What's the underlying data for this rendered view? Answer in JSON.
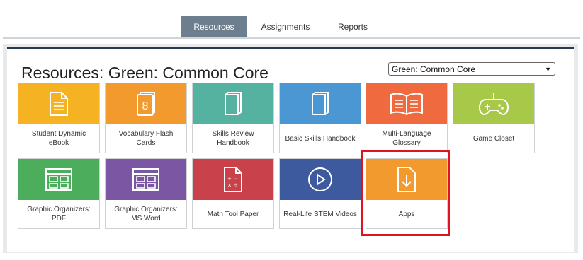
{
  "nav": {
    "tabs": [
      {
        "label": "Resources"
      },
      {
        "label": "Assignments"
      },
      {
        "label": "Reports"
      }
    ]
  },
  "page": {
    "title": "Resources: Green: Common Core",
    "select_value": "Green: Common Core"
  },
  "colors": {
    "nav_active": "#6d7f8e",
    "panel_header": "#273b4d",
    "highlight": "#e0141e"
  },
  "tiles": [
    {
      "label": "Student Dynamic eBook",
      "color": "#f5b324",
      "icon": "document-icon"
    },
    {
      "label": "Vocabulary Flash Cards",
      "color": "#f29a2e",
      "icon": "flashcards-icon"
    },
    {
      "label": "Skills Review Handbook",
      "color": "#56b2a0",
      "icon": "book-icon"
    },
    {
      "label": "Basic Skills Handbook",
      "color": "#4a97d3",
      "icon": "book-icon"
    },
    {
      "label": "Multi-Language Glossary",
      "color": "#ef6a3f",
      "icon": "open-book-icon"
    },
    {
      "label": "Game Closet",
      "color": "#a8c84a",
      "icon": "gamepad-icon"
    },
    {
      "label": "Graphic Organizers: PDF",
      "color": "#4cae5d",
      "icon": "organizer-icon"
    },
    {
      "label": "Graphic Organizers: MS Word",
      "color": "#7b57a3",
      "icon": "organizer-icon"
    },
    {
      "label": "Math Tool Paper",
      "color": "#c9414a",
      "icon": "math-paper-icon"
    },
    {
      "label": "Real-Life STEM Videos",
      "color": "#3d5a9f",
      "icon": "play-icon"
    },
    {
      "label": "Apps",
      "color": "#f29a2e",
      "icon": "download-icon"
    }
  ]
}
